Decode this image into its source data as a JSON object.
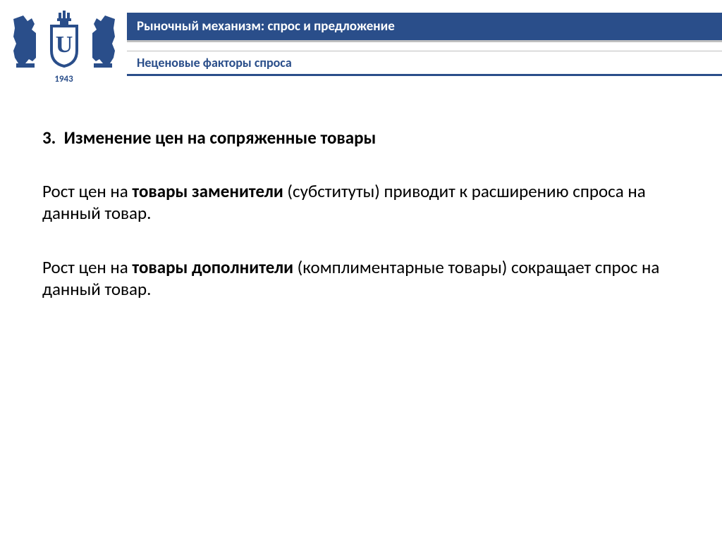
{
  "header": {
    "title": "Рыночный механизм: спрос и предложение",
    "subtitle": "Неценовые факторы спроса",
    "logo_year": "1943"
  },
  "content": {
    "heading_number": "3.",
    "heading_text": "Изменение цен на сопряженные товары",
    "para1_pre": "Рост цен на ",
    "para1_bold": "товары заменители",
    "para1_post": " (субституты) приводит к расширению спроса на данный товар.",
    "para2_pre": "Рост цен на ",
    "para2_bold": "товары дополнители",
    "para2_post": " (комплиментарные товары) сокращает спрос на данный товар."
  }
}
